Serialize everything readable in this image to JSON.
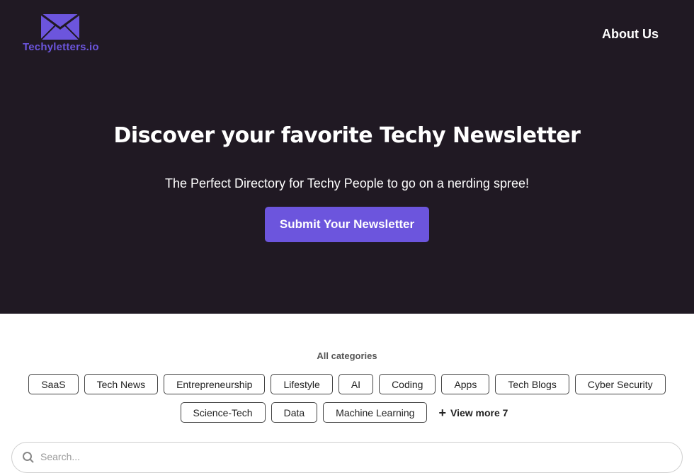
{
  "brand": {
    "name": "Techyletters.io",
    "icon": "envelope-icon",
    "color": "#6c55dd"
  },
  "nav": {
    "about": "About Us"
  },
  "hero": {
    "title": "Discover your favorite Techy Newsletter",
    "subtitle": "The Perfect Directory for Techy People to go on a nerding spree!",
    "cta": "Submit Your Newsletter",
    "background": "#201923"
  },
  "categories": {
    "title": "All categories",
    "row1": [
      "SaaS",
      "Tech News",
      "Entrepreneurship",
      "Lifestyle",
      "AI",
      "Coding",
      "Apps",
      "Tech Blogs",
      "Cyber Security"
    ],
    "row2": [
      "Science-Tech",
      "Data",
      "Machine Learning"
    ],
    "view_more": "View more 7"
  },
  "search": {
    "placeholder": "Search..."
  }
}
